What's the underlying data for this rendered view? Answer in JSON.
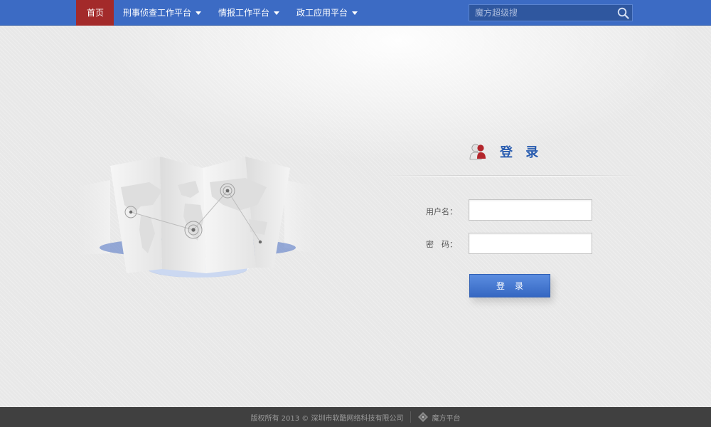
{
  "nav": {
    "items": [
      {
        "label": "首页",
        "active": true,
        "dropdown": false
      },
      {
        "label": "刑事侦查工作平台",
        "active": false,
        "dropdown": true
      },
      {
        "label": "情报工作平台",
        "active": false,
        "dropdown": true
      },
      {
        "label": "政工应用平台",
        "active": false,
        "dropdown": true
      }
    ],
    "search": {
      "placeholder": "魔方超级搜",
      "icon": "search-icon"
    }
  },
  "login": {
    "title": "登 录",
    "username_label": "用户名：",
    "username_value": "",
    "password_label": "密　码：",
    "password_value": "",
    "submit_label": "登录"
  },
  "footer": {
    "copyright": "版权所有 2013 © 深圳市软酷网络科技有限公司",
    "brand": "魔方平台"
  },
  "colors": {
    "nav_bg": "#3c6bc4",
    "nav_active": "#a32a2a",
    "accent": "#2a5db0",
    "footer_bg": "#404040"
  }
}
